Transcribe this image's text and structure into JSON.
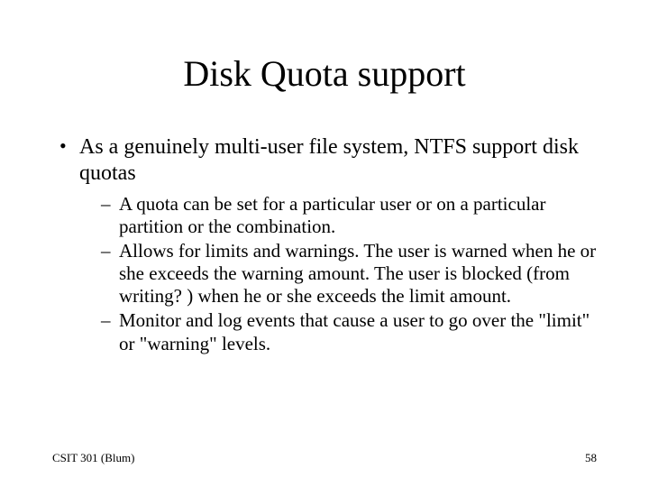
{
  "slide": {
    "title": "Disk Quota support",
    "bullets": [
      {
        "text": "As a genuinely multi-user file system, NTFS support disk quotas",
        "sub": [
          "A quota can be set for a particular user or on a particular partition or the combination.",
          "Allows for limits and warnings.  The user is warned when he or she exceeds the warning amount. The user is blocked (from writing? ) when he or she exceeds the limit amount.",
          "Monitor and log events that cause a user to go over the \"limit\" or \"warning\" levels."
        ]
      }
    ]
  },
  "footer": {
    "left": "CSIT 301 (Blum)",
    "right": "58"
  }
}
